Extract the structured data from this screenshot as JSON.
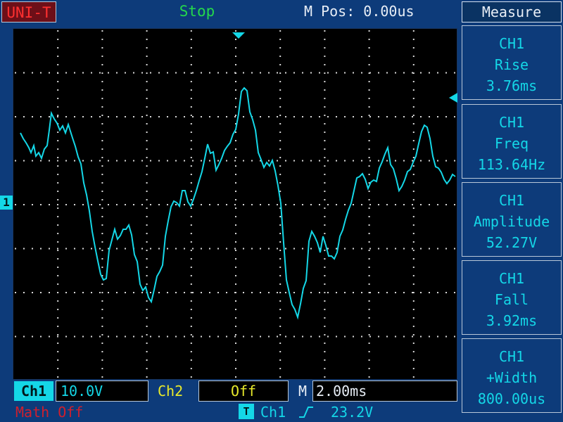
{
  "header": {
    "brand": "UNI-T",
    "status": "Stop",
    "m_pos": "M Pos: 0.00us",
    "measure_title": "Measure"
  },
  "markers": {
    "ch1": "1"
  },
  "measurements": [
    {
      "channel": "CH1",
      "name": "Rise",
      "value": "3.76ms"
    },
    {
      "channel": "CH1",
      "name": "Freq",
      "value": "113.64Hz"
    },
    {
      "channel": "CH1",
      "name": "Amplitude",
      "value": "52.27V"
    },
    {
      "channel": "CH1",
      "name": "Fall",
      "value": "3.92ms"
    },
    {
      "channel": "CH1",
      "name": "+Width",
      "value": "800.00us"
    }
  ],
  "footer": {
    "ch1_label": "Ch1",
    "ch1_scale": "10.0V",
    "ch2_label": "Ch2",
    "ch2_value": "Off",
    "timebase_label": "M",
    "timebase_value": "2.00ms",
    "math": "Math Off",
    "trigger_tag": "T",
    "trigger_channel": "Ch1",
    "trigger_level": "23.2V"
  },
  "colors": {
    "frame": "#0d3b7a",
    "screen": "#000000",
    "trace": "#14d7e7",
    "grid": "#d8d8d8",
    "status": "#24d84c",
    "ch2": "#e8ea2b",
    "math": "#d01f2d"
  },
  "icons": {
    "trigger_edge": "rising-edge-icon"
  }
}
